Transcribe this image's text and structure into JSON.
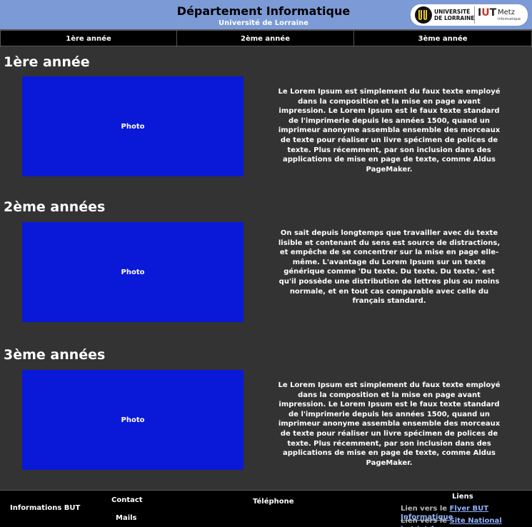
{
  "header": {
    "title": "Département Informatique",
    "subtitle": "Université de Lorraine",
    "logo_univ_line1": "UNIVERSITÉ",
    "logo_univ_line2": "DE LORRAINE",
    "logo_iut_i": "I",
    "logo_iut_u": "U",
    "logo_iut_t": "T",
    "logo_metz": "Metz",
    "logo_info": "Informatique"
  },
  "nav": {
    "tabs": [
      {
        "label": "1ère année"
      },
      {
        "label": "2ème année"
      },
      {
        "label": "3ème année"
      }
    ]
  },
  "sections": [
    {
      "title": "1ère année",
      "photo_label": "Photo",
      "text": "Le Lorem Ipsum est simplement du faux texte employé dans la composition et la mise en page avant impression. Le Lorem Ipsum est le faux texte standard de l'imprimerie depuis les années 1500, quand un imprimeur anonyme assembla ensemble des morceaux de texte pour réaliser un livre spécimen de polices de texte. Plus récemment, par son inclusion dans des applications de mise en page de texte, comme Aldus PageMaker."
    },
    {
      "title": "2ème années",
      "photo_label": "Photo",
      "text": "On sait depuis longtemps que travailler avec du texte lisible et contenant du sens est source de distractions, et empêche de se concentrer sur la mise en page elle-même. L'avantage du Lorem Ipsum sur un texte générique comme 'Du texte. Du texte. Du texte.' est qu'il possède une distribution de lettres plus ou moins normale, et en tout cas comparable avec celle du français standard."
    },
    {
      "title": "3ème années",
      "photo_label": "Photo",
      "text": "Le Lorem Ipsum est simplement du faux texte employé dans la composition et la mise en page avant impression. Le Lorem Ipsum est le faux texte standard de l'imprimerie depuis les années 1500, quand un imprimeur anonyme assembla ensemble des morceaux de texte pour réaliser un livre spécimen de polices de texte. Plus récemment, par son inclusion dans des applications de mise en page de texte, comme Aldus PageMaker."
    }
  ],
  "footer": {
    "info": "Informations BUT",
    "contact": "Contact",
    "mails": "Mails",
    "phone": "Téléphone",
    "links_title": "Liens",
    "link1_prefix": "Lien vers le",
    "link1_text": "Flyer BUT Informatique",
    "link2_prefix": "Lien vers le",
    "link2_text": "Site National but.iut.fr"
  },
  "colors": {
    "header_bg": "#7b9ad6",
    "photo_bg": "#0a18d8",
    "page_bg": "#333333",
    "link": "#8fb2ff"
  }
}
